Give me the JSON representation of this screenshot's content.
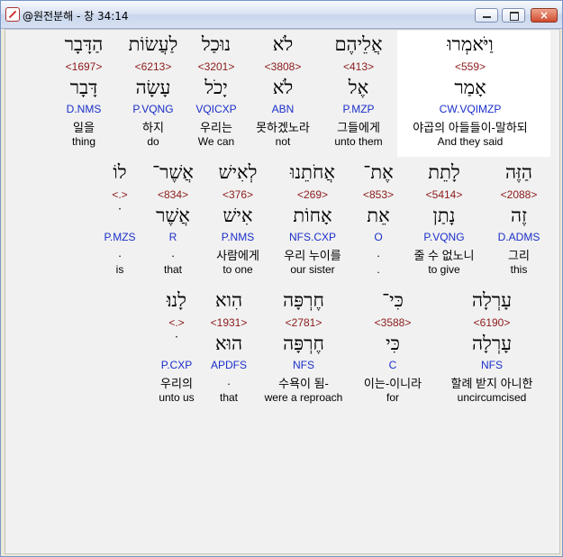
{
  "window": {
    "title": "@원전분해 - 창 34:14",
    "buttons": {
      "minimize": "minimize",
      "maximize": "maximize",
      "close": "×"
    }
  },
  "rows": [
    {
      "words": [
        {
          "heb": "וַיֹּאמְרוּ",
          "strong": "<559>",
          "lex": "אָמַר",
          "morph": "CW.VQIMZP",
          "kor": "야곱의 아들들이-말하되",
          "eng": "And they said"
        },
        {
          "heb": "אֲלֵיהֶם",
          "strong": "<413>",
          "lex": "אֶל",
          "morph": "P.MZP",
          "kor": "그들에게",
          "eng": "unto them"
        },
        {
          "heb": "לֹא",
          "strong": "<3808>",
          "lex": "לֹא",
          "morph": "ABN",
          "kor": "못하겠노라",
          "eng": "not"
        },
        {
          "heb": "נוּכַל",
          "strong": "<3201>",
          "lex": "יָכֹל",
          "morph": "VQICXP",
          "kor": "우리는",
          "eng": "We can"
        },
        {
          "heb": "לַעֲשׂוֹת",
          "strong": "<6213>",
          "lex": "עָשָׂה",
          "morph": "P.VQNG",
          "kor": "하지",
          "eng": "do"
        },
        {
          "heb": "הַדָּבָר",
          "strong": "<1697>",
          "lex": "דָּבָר",
          "morph": "D.NMS",
          "kor": "일을",
          "eng": "thing"
        }
      ]
    },
    {
      "words": [
        {
          "heb": "הַזֶּה",
          "strong": "<2088>",
          "lex": "זֶה",
          "morph": "D.ADMS",
          "kor": "그리",
          "eng": "this"
        },
        {
          "heb": "לָתֵת",
          "strong": "<5414>",
          "lex": "נָתַן",
          "morph": "P.VQNG",
          "kor": "줄 수 없노니",
          "eng": "to give"
        },
        {
          "heb": "אֶת־",
          "strong": "<853>",
          "lex": "אֵת",
          "morph": "O",
          "kor": ".",
          "eng": "."
        },
        {
          "heb": "אֲחֹתֵנוּ",
          "strong": "<269>",
          "lex": "אָחוֹת",
          "morph": "NFS.CXP",
          "kor": "우리 누이를",
          "eng": "our sister"
        },
        {
          "heb": "לְאִישׁ",
          "strong": "<376>",
          "lex": "אִישׁ",
          "morph": "P.NMS",
          "kor": "사람에게",
          "eng": "to one"
        },
        {
          "heb": "אֲשֶׁר־",
          "strong": "<834>",
          "lex": "אֲשֶׁר",
          "morph": "R",
          "kor": ".",
          "eng": "that"
        },
        {
          "heb": "לוֹ",
          "strong": "<.>",
          "lex": "ׁ",
          "morph": "P.MZS",
          "kor": ".",
          "eng": "is"
        }
      ]
    },
    {
      "words": [
        {
          "heb": "עָרְלָה",
          "strong": "<6190>",
          "lex": "עָרְלָה",
          "morph": "NFS",
          "kor": "할례 받지 아니한",
          "eng": "uncircumcised"
        },
        {
          "heb": "כִּי־",
          "strong": "<3588>",
          "lex": "כִּי",
          "morph": "C",
          "kor": "이는-이니라",
          "eng": "for"
        },
        {
          "heb": "חֶרְפָּה",
          "strong": "<2781>",
          "lex": "חֶרְפָּה",
          "morph": "NFS",
          "kor": "수욕이 됨-",
          "eng": "were a reproach"
        },
        {
          "heb": "הִוא",
          "strong": "<1931>",
          "lex": "הוּא",
          "morph": "APDFS",
          "kor": ".",
          "eng": "that"
        },
        {
          "heb": "לָנוּ׃",
          "strong": "<.>",
          "lex": "ׁ",
          "morph": "P.CXP",
          "kor": "우리의",
          "eng": "unto us"
        }
      ]
    }
  ]
}
